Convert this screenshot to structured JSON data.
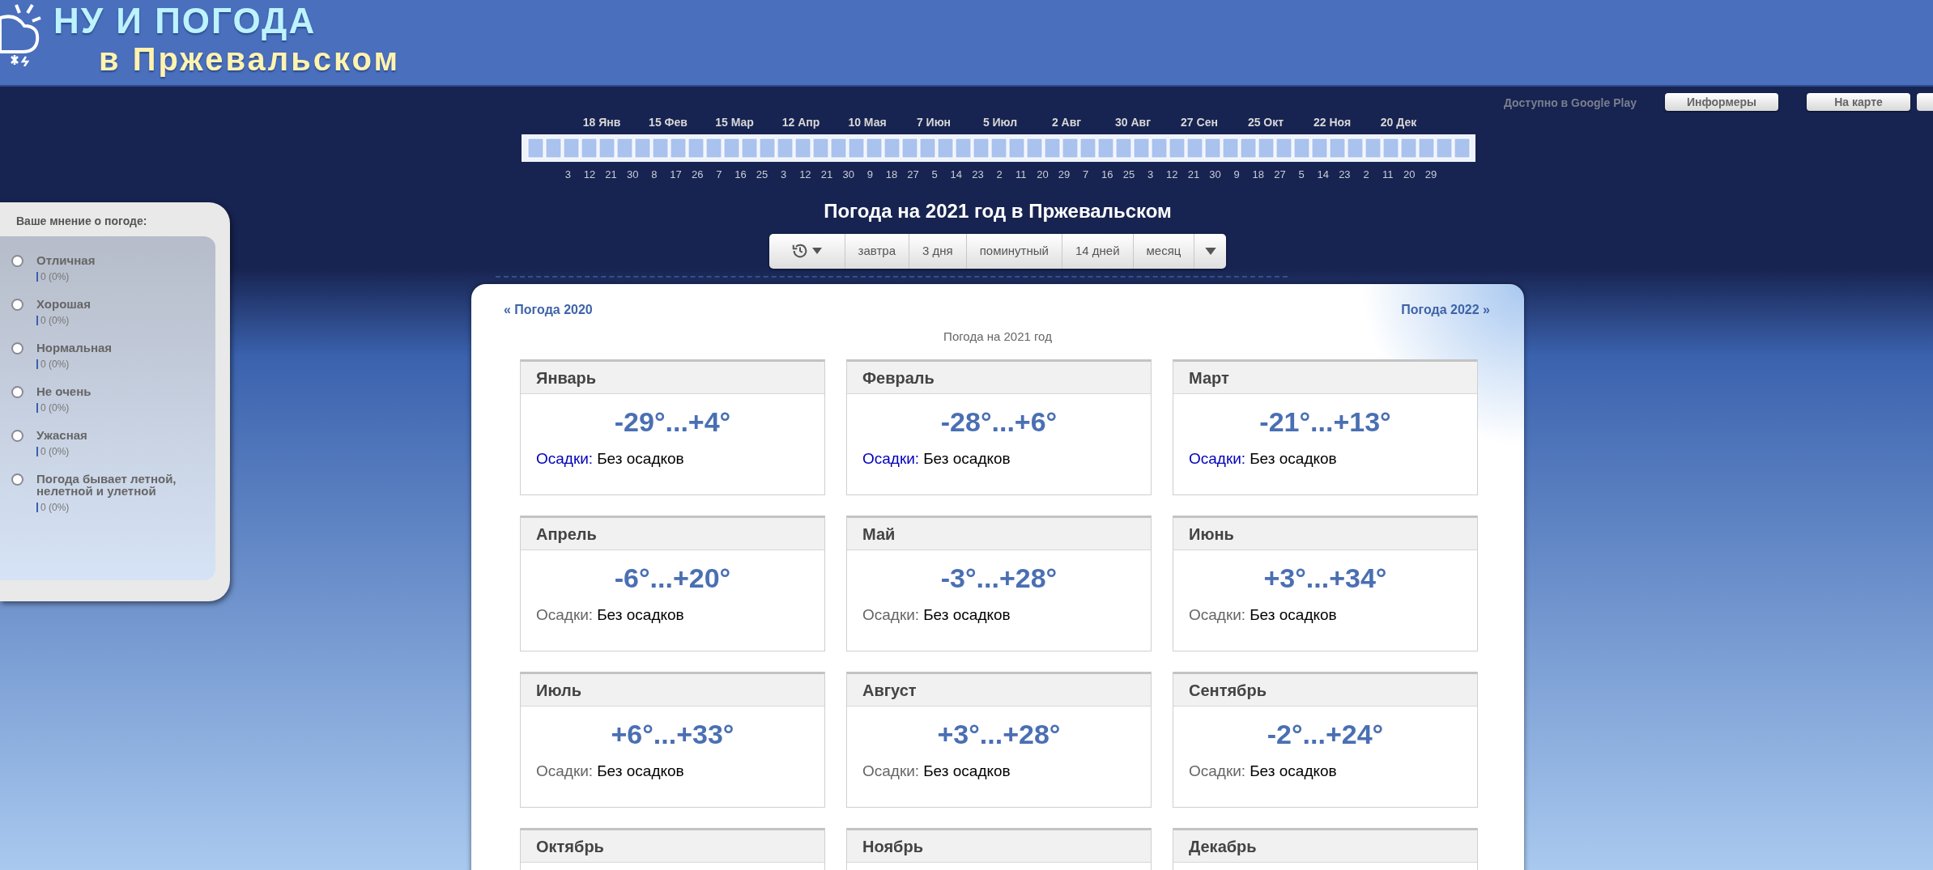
{
  "header": {
    "logo_line1": "НУ И ПОГОДА",
    "logo_line2": "в Пржевальском"
  },
  "top_links": {
    "google_play": "Доступно в Google Play",
    "buttons": [
      "Информеры",
      "На карте"
    ]
  },
  "timeline": {
    "months": [
      "18 Янв",
      "15 Фев",
      "15 Мар",
      "12 Апр",
      "10 Мая",
      "7 Июн",
      "5 Июл",
      "2 Авг",
      "30 Авг",
      "27 Сен",
      "25 Окт",
      "22 Ноя",
      "20 Дек"
    ],
    "days": [
      "3",
      "12",
      "21",
      "30",
      "8",
      "17",
      "26",
      "7",
      "16",
      "25",
      "3",
      "12",
      "21",
      "30",
      "9",
      "18",
      "27",
      "5",
      "14",
      "23",
      "2",
      "11",
      "20",
      "29",
      "7",
      "16",
      "25",
      "3",
      "12",
      "21",
      "30",
      "9",
      "18",
      "27",
      "5",
      "14",
      "23",
      "2",
      "11",
      "20",
      "29"
    ]
  },
  "title": "Погода на 2021 год в Пржевальском",
  "toolbar": {
    "items": [
      {
        "kind": "history"
      },
      {
        "kind": "text",
        "label": "завтра"
      },
      {
        "kind": "text",
        "label": "3 дня"
      },
      {
        "kind": "text",
        "label": "поминутный"
      },
      {
        "kind": "text",
        "label": "14 дней"
      },
      {
        "kind": "text",
        "label": "месяц"
      },
      {
        "kind": "more"
      }
    ]
  },
  "poll": {
    "title": "Ваше мнение о погоде:",
    "options": [
      {
        "label": "Отличная",
        "count": "0 (0%)",
        "selected": false
      },
      {
        "label": "Хорошая",
        "count": "0 (0%)",
        "selected": false
      },
      {
        "label": "Нормальная",
        "count": "0 (0%)",
        "selected": false
      },
      {
        "label": "Не очень",
        "count": "0 (0%)",
        "selected": false
      },
      {
        "label": "Ужасная",
        "count": "0 (0%)",
        "selected": false
      },
      {
        "label": "Погода бывает летной, нелетной и улетной",
        "count": "0 (0%)",
        "selected": false
      }
    ]
  },
  "panel": {
    "prev": "« Погода 2020",
    "next": "Погода 2022 »",
    "subtitle": "Погода на 2021 год",
    "months": [
      {
        "name": "Январь",
        "temp": "-29°...+4°",
        "precip_label": "Осадки:",
        "precip": "Без осадков",
        "link": true
      },
      {
        "name": "Февраль",
        "temp": "-28°...+6°",
        "precip_label": "Осадки:",
        "precip": "Без осадков",
        "link": true
      },
      {
        "name": "Март",
        "temp": "-21°...+13°",
        "precip_label": "Осадки:",
        "precip": "Без осадков",
        "link": true
      },
      {
        "name": "Апрель",
        "temp": "-6°...+20°",
        "precip_label": "Осадки:",
        "precip": "Без осадков",
        "link": false
      },
      {
        "name": "Май",
        "temp": "-3°...+28°",
        "precip_label": "Осадки:",
        "precip": "Без осадков",
        "link": false
      },
      {
        "name": "Июнь",
        "temp": "+3°...+34°",
        "precip_label": "Осадки:",
        "precip": "Без осадков",
        "link": false
      },
      {
        "name": "Июль",
        "temp": "+6°...+33°",
        "precip_label": "Осадки:",
        "precip": "Без осадков",
        "link": false
      },
      {
        "name": "Август",
        "temp": "+3°...+28°",
        "precip_label": "Осадки:",
        "precip": "Без осадков",
        "link": false
      },
      {
        "name": "Сентябрь",
        "temp": "-2°...+24°",
        "precip_label": "Осадки:",
        "precip": "Без осадков",
        "link": false
      },
      {
        "name": "Октябрь"
      },
      {
        "name": "Ноябрь"
      },
      {
        "name": "Декабрь"
      }
    ]
  }
}
